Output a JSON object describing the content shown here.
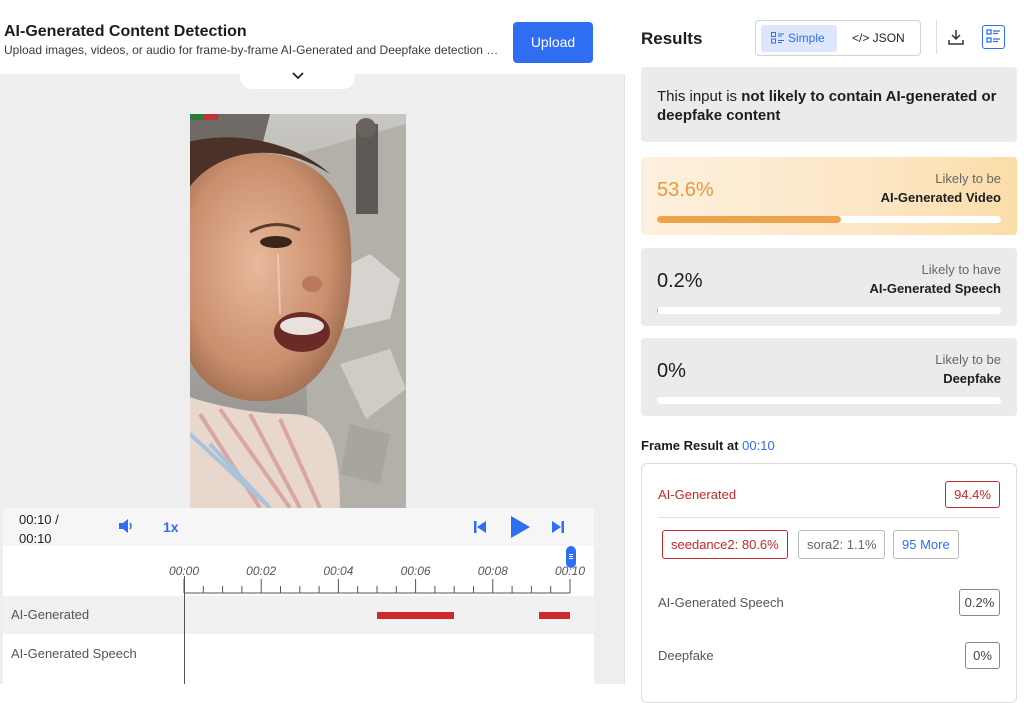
{
  "header": {
    "title": "AI-Generated Content Detection",
    "subtitle": "Upload images, videos, or audio for frame-by-frame AI-Generated and Deepfake detection with...",
    "upload_label": "Upload"
  },
  "player": {
    "time_current": "00:10 /",
    "time_total": "00:10",
    "speed": "1x",
    "icons": [
      "volume-icon",
      "skip-back-icon",
      "play-icon",
      "skip-forward-icon"
    ]
  },
  "timeline": {
    "tick_labels": [
      "00:00",
      "00:02",
      "00:04",
      "00:06",
      "00:08",
      "00:10"
    ],
    "playhead_seconds": 0,
    "tracks": [
      {
        "label": "AI-Generated",
        "segments": [
          [
            5.0,
            7.0
          ],
          [
            9.2,
            10.0
          ]
        ]
      },
      {
        "label": "AI-Generated Speech",
        "segments": []
      }
    ]
  },
  "results": {
    "title": "Results",
    "view_simple": "Simple",
    "view_json": "</> JSON",
    "summary_prefix": "This input is ",
    "summary_bold": "not likely to contain AI-generated or deepfake content",
    "cards": [
      {
        "percent": "53.6%",
        "value": 0.536,
        "line1": "Likely to be",
        "line2": "AI-Generated Video"
      },
      {
        "percent": "0.2%",
        "value": 0.002,
        "line1": "Likely to have",
        "line2": "AI-Generated Speech"
      },
      {
        "percent": "0%",
        "value": 0,
        "line1": "Likely to be",
        "line2": "Deepfake"
      }
    ],
    "frame": {
      "title": "Frame Result at ",
      "time": "00:10",
      "ai_label": "AI-Generated",
      "ai_value": "94.4%",
      "chips": [
        "seedance2: 80.6%",
        "sora2: 1.1%",
        "95 More"
      ],
      "speech_label": "AI-Generated Speech",
      "speech_value": "0.2%",
      "deepfake_label": "Deepfake",
      "deepfake_value": "0%"
    }
  },
  "colors": {
    "accent": "#2f6ef0",
    "danger": "#c7282b",
    "warning": "#eda34b"
  }
}
